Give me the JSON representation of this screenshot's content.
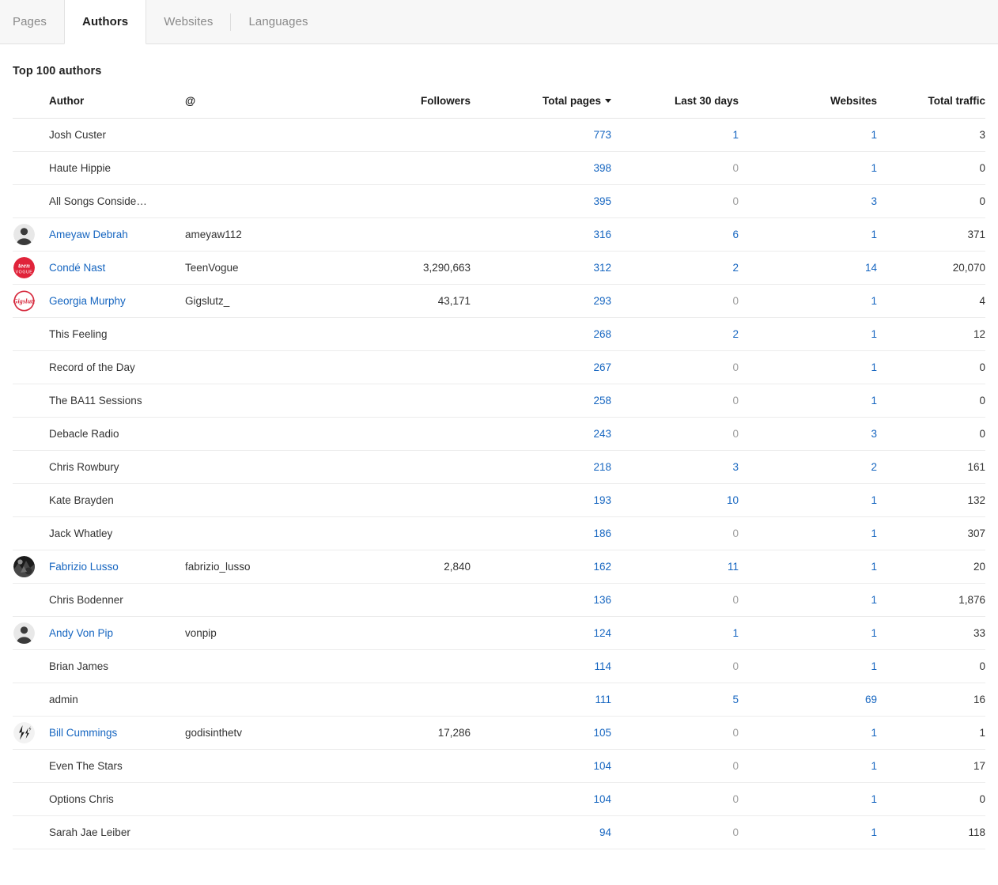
{
  "tabs": [
    {
      "label": "Pages",
      "active": false
    },
    {
      "label": "Authors",
      "active": true
    },
    {
      "label": "Websites",
      "active": false
    },
    {
      "label": "Languages",
      "active": false
    }
  ],
  "section": {
    "title": "Top 100 authors"
  },
  "colors": {
    "link": "#1565c0",
    "text": "#333333",
    "muted": "#9b9b9b",
    "tabbar_bg": "#f7f7f7",
    "border": "#ececec",
    "avatar_red": "#e02434"
  },
  "table": {
    "columns": [
      {
        "key": "avatar",
        "label": "",
        "align": "left"
      },
      {
        "key": "author",
        "label": "Author",
        "align": "left"
      },
      {
        "key": "handle",
        "label": "@",
        "align": "left"
      },
      {
        "key": "followers",
        "label": "Followers",
        "align": "right"
      },
      {
        "key": "pages",
        "label": "Total pages",
        "align": "right",
        "sorted": true,
        "sort_dir": "desc"
      },
      {
        "key": "last30",
        "label": "Last 30 days",
        "align": "right"
      },
      {
        "key": "websites",
        "label": "Websites",
        "align": "right"
      },
      {
        "key": "traffic",
        "label": "Total traffic",
        "align": "right"
      }
    ],
    "rows": [
      {
        "avatar": "none",
        "author": "Josh Custer",
        "author_link": false,
        "handle": "",
        "followers": "",
        "pages": "773",
        "last30": "1",
        "websites": "1",
        "traffic": "3"
      },
      {
        "avatar": "none",
        "author": "Haute Hippie",
        "author_link": false,
        "handle": "",
        "followers": "",
        "pages": "398",
        "last30": "0",
        "websites": "1",
        "traffic": "0"
      },
      {
        "avatar": "none",
        "author": "All Songs Conside…",
        "author_link": false,
        "handle": "",
        "followers": "",
        "pages": "395",
        "last30": "0",
        "websites": "3",
        "traffic": "0"
      },
      {
        "avatar": "person",
        "author": "Ameyaw Debrah",
        "author_link": true,
        "handle": "ameyaw112",
        "followers": "",
        "pages": "316",
        "last30": "6",
        "websites": "1",
        "traffic": "371"
      },
      {
        "avatar": "teenvogue",
        "author": "Condé Nast",
        "author_link": true,
        "handle": "TeenVogue",
        "followers": "3,290,663",
        "pages": "312",
        "last30": "2",
        "websites": "14",
        "traffic": "20,070"
      },
      {
        "avatar": "gigslutz",
        "author": "Georgia Murphy",
        "author_link": true,
        "handle": "Gigslutz_",
        "followers": "43,171",
        "pages": "293",
        "last30": "0",
        "websites": "1",
        "traffic": "4"
      },
      {
        "avatar": "none",
        "author": "This Feeling",
        "author_link": false,
        "handle": "",
        "followers": "",
        "pages": "268",
        "last30": "2",
        "websites": "1",
        "traffic": "12"
      },
      {
        "avatar": "none",
        "author": "Record of the Day",
        "author_link": false,
        "handle": "",
        "followers": "",
        "pages": "267",
        "last30": "0",
        "websites": "1",
        "traffic": "0"
      },
      {
        "avatar": "none",
        "author": "The BA11 Sessions",
        "author_link": false,
        "handle": "",
        "followers": "",
        "pages": "258",
        "last30": "0",
        "websites": "1",
        "traffic": "0"
      },
      {
        "avatar": "none",
        "author": "Debacle Radio",
        "author_link": false,
        "handle": "",
        "followers": "",
        "pages": "243",
        "last30": "0",
        "websites": "3",
        "traffic": "0"
      },
      {
        "avatar": "none",
        "author": "Chris Rowbury",
        "author_link": false,
        "handle": "",
        "followers": "",
        "pages": "218",
        "last30": "3",
        "websites": "2",
        "traffic": "161"
      },
      {
        "avatar": "none",
        "author": "Kate Brayden",
        "author_link": false,
        "handle": "",
        "followers": "",
        "pages": "193",
        "last30": "10",
        "websites": "1",
        "traffic": "132"
      },
      {
        "avatar": "none",
        "author": "Jack Whatley",
        "author_link": false,
        "handle": "",
        "followers": "",
        "pages": "186",
        "last30": "0",
        "websites": "1",
        "traffic": "307"
      },
      {
        "avatar": "photo-dark",
        "author": "Fabrizio Lusso",
        "author_link": true,
        "handle": "fabrizio_lusso",
        "followers": "2,840",
        "pages": "162",
        "last30": "11",
        "websites": "1",
        "traffic": "20"
      },
      {
        "avatar": "none",
        "author": "Chris Bodenner",
        "author_link": false,
        "handle": "",
        "followers": "",
        "pages": "136",
        "last30": "0",
        "websites": "1",
        "traffic": "1,876"
      },
      {
        "avatar": "person",
        "author": "Andy Von Pip",
        "author_link": true,
        "handle": "vonpip",
        "followers": "",
        "pages": "124",
        "last30": "1",
        "websites": "1",
        "traffic": "33"
      },
      {
        "avatar": "none",
        "author": "Brian James",
        "author_link": false,
        "handle": "",
        "followers": "",
        "pages": "114",
        "last30": "0",
        "websites": "1",
        "traffic": "0"
      },
      {
        "avatar": "none",
        "author": "admin",
        "author_link": false,
        "handle": "",
        "followers": "",
        "pages": "111",
        "last30": "5",
        "websites": "69",
        "traffic": "16"
      },
      {
        "avatar": "lightning",
        "author": "Bill Cummings",
        "author_link": true,
        "handle": "godisinthetv",
        "followers": "17,286",
        "pages": "105",
        "last30": "0",
        "websites": "1",
        "traffic": "1"
      },
      {
        "avatar": "none",
        "author": "Even The Stars",
        "author_link": false,
        "handle": "",
        "followers": "",
        "pages": "104",
        "last30": "0",
        "websites": "1",
        "traffic": "17"
      },
      {
        "avatar": "none",
        "author": "Options Chris",
        "author_link": false,
        "handle": "",
        "followers": "",
        "pages": "104",
        "last30": "0",
        "websites": "1",
        "traffic": "0"
      },
      {
        "avatar": "none",
        "author": "Sarah Jae Leiber",
        "author_link": false,
        "handle": "",
        "followers": "",
        "pages": "94",
        "last30": "0",
        "websites": "1",
        "traffic": "118"
      }
    ]
  }
}
